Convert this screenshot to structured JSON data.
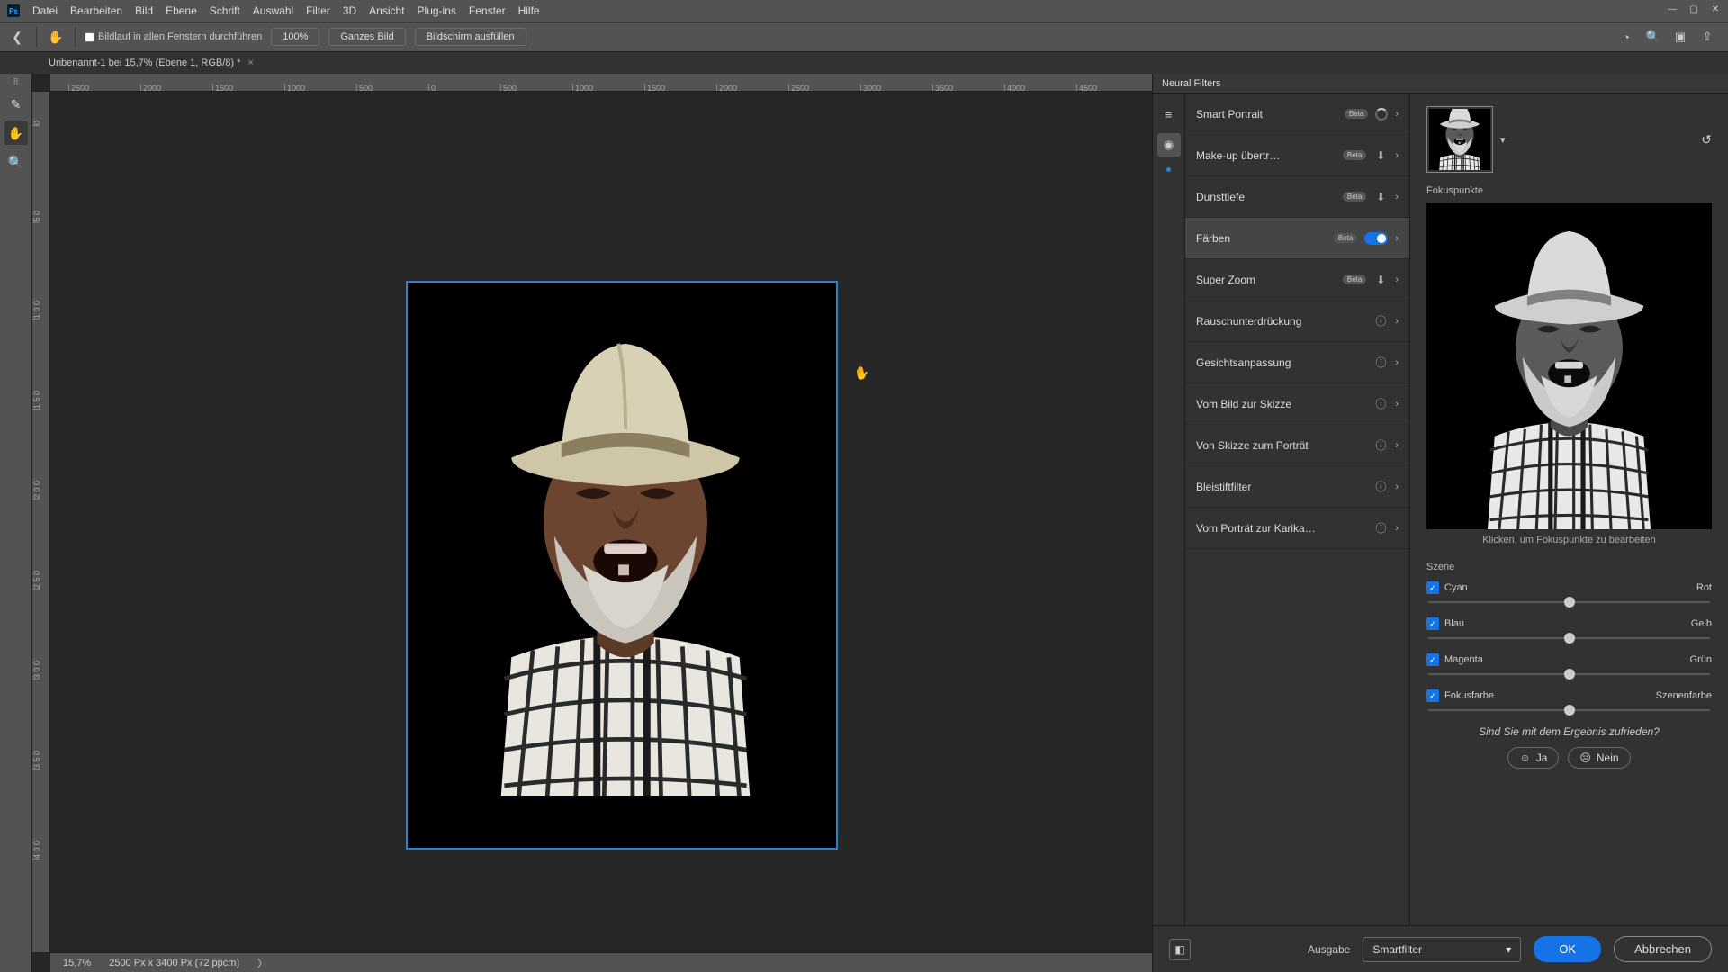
{
  "app_icon": "Ps",
  "menu": [
    "Datei",
    "Bearbeiten",
    "Bild",
    "Ebene",
    "Schrift",
    "Auswahl",
    "Filter",
    "3D",
    "Ansicht",
    "Plug-ins",
    "Fenster",
    "Hilfe"
  ],
  "options": {
    "scroll_all": "Bildlauf in allen Fenstern durchführen",
    "zoom100": "100%",
    "fit_screen": "Ganzes Bild",
    "fill_screen": "Bildschirm ausfüllen"
  },
  "tab": {
    "title": "Unbenannt-1 bei 15,7% (Ebene 1, RGB/8) *"
  },
  "ruler_h": [
    "2500",
    "2000",
    "1500",
    "1000",
    "500",
    "0",
    "500",
    "1000",
    "1500",
    "2000",
    "2500",
    "3000",
    "3500",
    "4000",
    "4500"
  ],
  "ruler_v": [
    "0",
    "5 0",
    "1 0 0",
    "1 5 0",
    "2 0 0",
    "2 5 0",
    "3 0 0",
    "3 5 0",
    "4 0 0"
  ],
  "status": {
    "zoom": "15,7%",
    "dims": "2500 Px x 3400 Px (72 ppcm)",
    "chev": "〉"
  },
  "nf": {
    "title": "Neural Filters",
    "filters": [
      {
        "name": "Smart Portrait",
        "beta": true,
        "ctrl": "spinner"
      },
      {
        "name": "Make-up übertr…",
        "beta": true,
        "ctrl": "download"
      },
      {
        "name": "Dunsttiefe",
        "beta": true,
        "ctrl": "download"
      },
      {
        "name": "Färben",
        "beta": true,
        "ctrl": "toggle-on",
        "selected": true
      },
      {
        "name": "Super Zoom",
        "beta": true,
        "ctrl": "download"
      },
      {
        "name": "Rauschunterdrückung",
        "beta": false,
        "ctrl": "info"
      },
      {
        "name": "Gesichtsanpassung",
        "beta": false,
        "ctrl": "info"
      },
      {
        "name": "Vom Bild zur Skizze",
        "beta": false,
        "ctrl": "info"
      },
      {
        "name": "Von Skizze zum Porträt",
        "beta": false,
        "ctrl": "info"
      },
      {
        "name": "Bleistiftfilter",
        "beta": false,
        "ctrl": "info"
      },
      {
        "name": "Vom Porträt zur Karika…",
        "beta": false,
        "ctrl": "info"
      }
    ],
    "focus_label": "Fokuspunkte",
    "preview_caption": "Klicken, um Fokuspunkte zu bearbeiten",
    "scene_label": "Szene",
    "sliders": [
      {
        "left": "Cyan",
        "right": "Rot"
      },
      {
        "left": "Blau",
        "right": "Gelb"
      },
      {
        "left": "Magenta",
        "right": "Grün"
      },
      {
        "left": "Fokusfarbe",
        "right": "Szenenfarbe"
      }
    ],
    "feedback": "Sind Sie mit dem Ergebnis zufrieden?",
    "yes": "Ja",
    "no": "Nein",
    "output_label": "Ausgabe",
    "output_value": "Smartfilter",
    "ok": "OK",
    "cancel": "Abbrechen"
  }
}
